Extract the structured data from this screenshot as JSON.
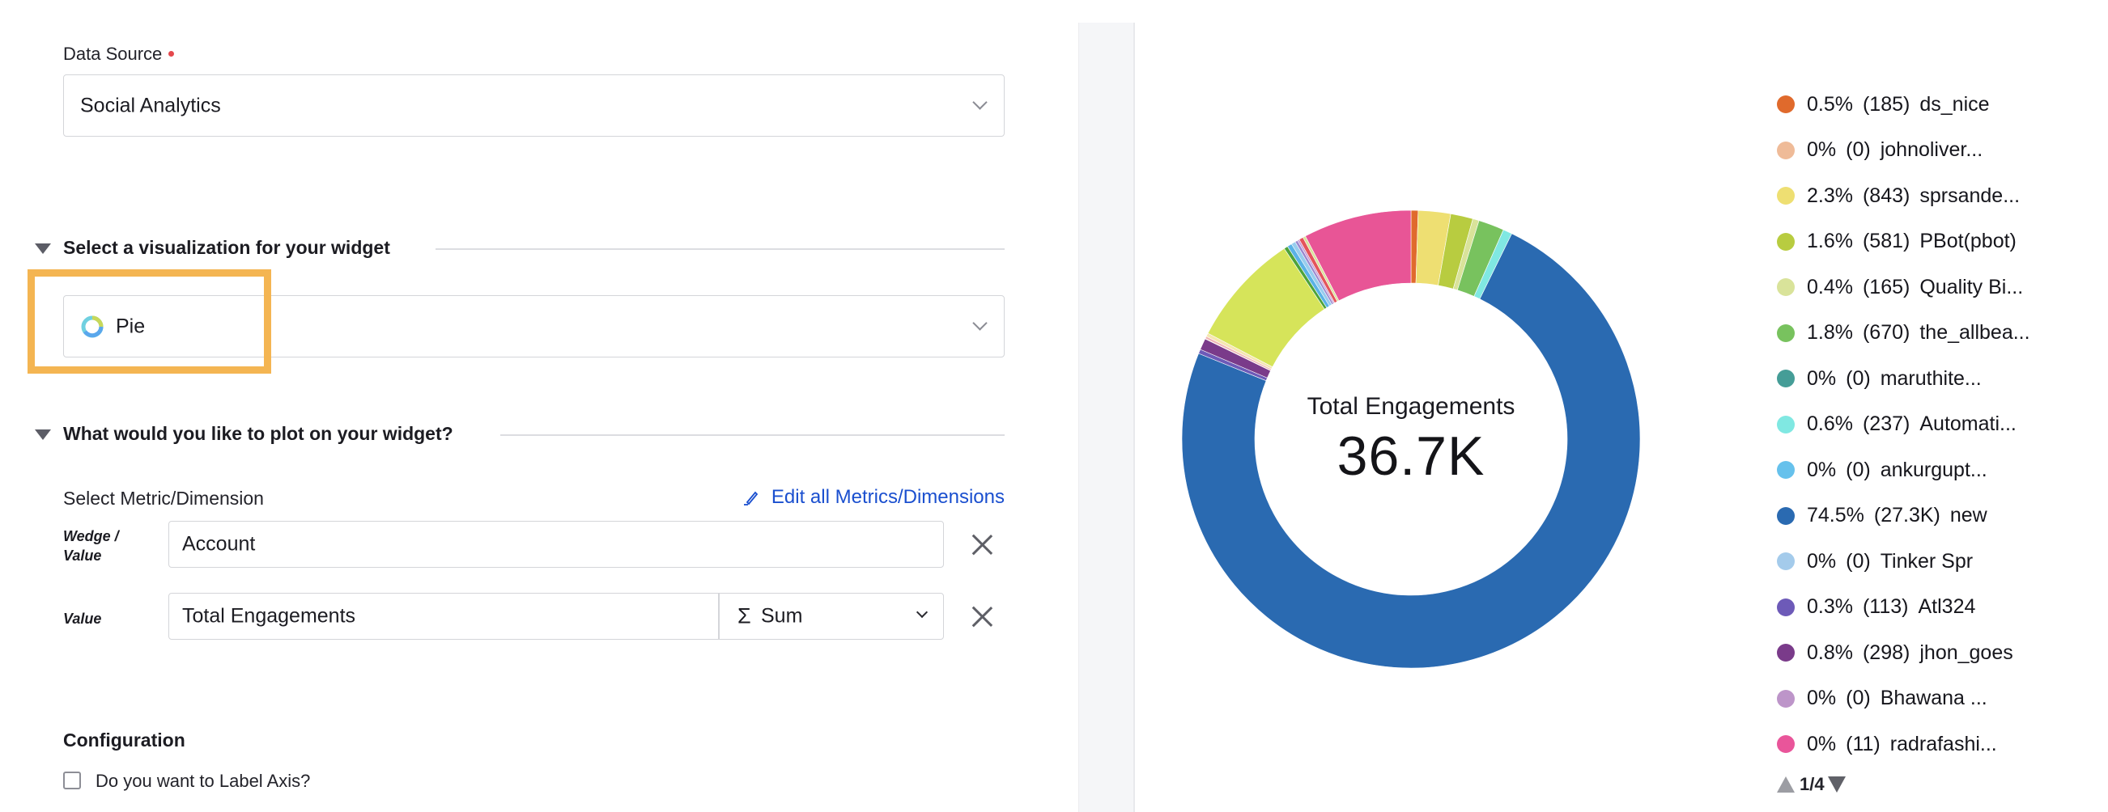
{
  "form": {
    "data_source": {
      "label": "Data Source",
      "value": "Social Analytics"
    },
    "visualization_section": {
      "title": "Select a visualization for your widget",
      "selected": "Pie",
      "icon": "donut-chart-icon"
    },
    "plot_section": {
      "title": "What would you like to plot on your widget?",
      "select_label": "Select Metric/Dimension",
      "edit_link": "Edit all Metrics/Dimensions",
      "edit_icon": "pencil-icon",
      "rows": [
        {
          "label_line1": "Wedge /",
          "label_line2": "Value",
          "value": "Account"
        },
        {
          "label_line1": "Value",
          "label_line2": "",
          "value": "Total Engagements",
          "aggregation_symbol": "Σ",
          "aggregation": "Sum"
        }
      ]
    },
    "configuration": {
      "title": "Configuration",
      "label_axis_checkbox": "Do you want to Label Axis?",
      "label_axis_checked": false
    }
  },
  "chart_data": {
    "type": "pie",
    "variant": "donut",
    "center_label": "Total Engagements",
    "center_value": "36.7K",
    "total": 36700,
    "legend_placement": "right",
    "legend_page": "1/4",
    "series": [
      {
        "name": "ds_nice",
        "percent": "0.5%",
        "value_label": "185",
        "value": 185,
        "color": "#e06a2c"
      },
      {
        "name": "johnoliver...",
        "percent": "0%",
        "value_label": "0",
        "value": 0,
        "color": "#efbb98"
      },
      {
        "name": "sprsande...",
        "percent": "2.3%",
        "value_label": "843",
        "value": 843,
        "color": "#eedf72"
      },
      {
        "name": "PBot(pbot)",
        "percent": "1.6%",
        "value_label": "581",
        "value": 581,
        "color": "#b8cc40"
      },
      {
        "name": "Quality Bi...",
        "percent": "0.4%",
        "value_label": "165",
        "value": 165,
        "color": "#d9e39a"
      },
      {
        "name": "the_allbea...",
        "percent": "1.8%",
        "value_label": "670",
        "value": 670,
        "color": "#78c25e"
      },
      {
        "name": "maruthite...",
        "percent": "0%",
        "value_label": "0",
        "value": 0,
        "color": "#459d97"
      },
      {
        "name": "Automati...",
        "percent": "0.6%",
        "value_label": "237",
        "value": 237,
        "color": "#80e8e2"
      },
      {
        "name": "ankurgupt...",
        "percent": "0%",
        "value_label": "0",
        "value": 0,
        "color": "#66c1ec"
      },
      {
        "name": "new",
        "percent": "74.5%",
        "value_label": "27.3K",
        "value": 27300,
        "color": "#2a6ab1"
      },
      {
        "name": "Tinker Spr",
        "percent": "0%",
        "value_label": "0",
        "value": 0,
        "color": "#a4cbeb"
      },
      {
        "name": "Atl324",
        "percent": "0.3%",
        "value_label": "113",
        "value": 113,
        "color": "#6d5ab8"
      },
      {
        "name": "jhon_goes",
        "percent": "0.8%",
        "value_label": "298",
        "value": 298,
        "color": "#7a3b8a"
      },
      {
        "name": "Bhawana ...",
        "percent": "0%",
        "value_label": "0",
        "value": 0,
        "color": "#bd95c9"
      },
      {
        "name": "radrafashi...",
        "percent": "0%",
        "value_label": "11",
        "value": 11,
        "color": "#e9559a"
      }
    ],
    "unlabeled_arcs_from_other_legend_pages": [
      {
        "value": 60,
        "color": "#f0b4b4"
      },
      {
        "value": 90,
        "color": "#f5e6b0"
      },
      {
        "value": 2960,
        "color": "#d6e45a"
      },
      {
        "value": 100,
        "color": "#4ea33a"
      },
      {
        "value": 120,
        "color": "#5ab2e6"
      },
      {
        "value": 110,
        "color": "#98cdee"
      },
      {
        "value": 70,
        "color": "#9b88cf"
      },
      {
        "value": 50,
        "color": "#c79ad3"
      },
      {
        "value": 110,
        "color": "#e4555a"
      },
      {
        "value": 70,
        "color": "#d9e39a"
      },
      {
        "value": 2820,
        "color": "#e85596"
      }
    ]
  },
  "legend_pager": {
    "label": "1/4",
    "prev_icon": "triangle-up-icon",
    "next_icon": "triangle-down-icon"
  }
}
